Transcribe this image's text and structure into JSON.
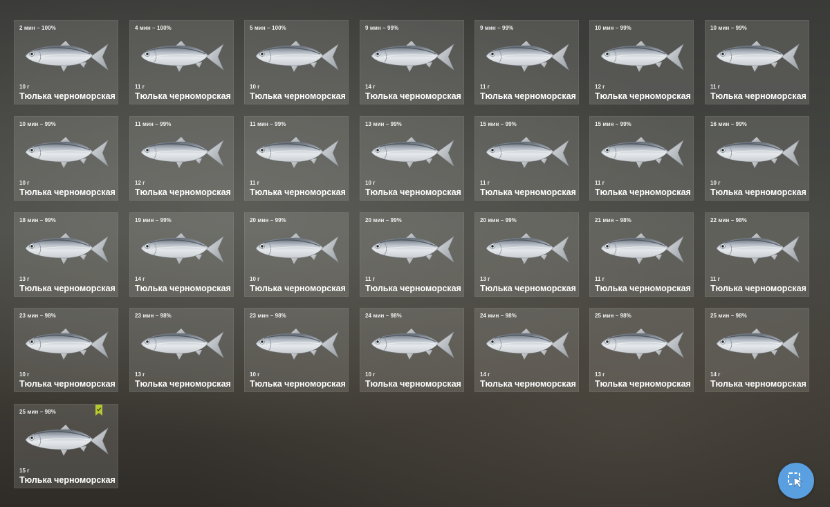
{
  "species_name": "Тюлька черноморская",
  "catches": [
    {
      "time": "2 мин – 100%",
      "weight": "10 г"
    },
    {
      "time": "4 мин – 100%",
      "weight": "11 г"
    },
    {
      "time": "5 мин – 100%",
      "weight": "10 г"
    },
    {
      "time": "9 мин – 99%",
      "weight": "14 г"
    },
    {
      "time": "9 мин – 99%",
      "weight": "11 г"
    },
    {
      "time": "10 мин – 99%",
      "weight": "12 г"
    },
    {
      "time": "10 мин – 99%",
      "weight": "11 г"
    },
    {
      "time": "10 мин – 99%",
      "weight": "10 г"
    },
    {
      "time": "11 мин – 99%",
      "weight": "12 г"
    },
    {
      "time": "11 мин – 99%",
      "weight": "11 г"
    },
    {
      "time": "13 мин – 99%",
      "weight": "10 г"
    },
    {
      "time": "15 мин – 99%",
      "weight": "11 г"
    },
    {
      "time": "15 мин – 99%",
      "weight": "11 г"
    },
    {
      "time": "16 мин – 99%",
      "weight": "10 г"
    },
    {
      "time": "18 мин – 99%",
      "weight": "13 г"
    },
    {
      "time": "19 мин – 99%",
      "weight": "14 г"
    },
    {
      "time": "20 мин – 99%",
      "weight": "10 г"
    },
    {
      "time": "20 мин – 99%",
      "weight": "11 г"
    },
    {
      "time": "20 мин – 99%",
      "weight": "13 г"
    },
    {
      "time": "21 мин – 98%",
      "weight": "11 г"
    },
    {
      "time": "22 мин – 98%",
      "weight": "11 г"
    },
    {
      "time": "23 мин – 98%",
      "weight": "10 г"
    },
    {
      "time": "23 мин – 98%",
      "weight": "13 г"
    },
    {
      "time": "23 мин – 98%",
      "weight": "10 г"
    },
    {
      "time": "24 мин – 98%",
      "weight": "10 г"
    },
    {
      "time": "24 мин – 98%",
      "weight": "14 г"
    },
    {
      "time": "25 мин – 98%",
      "weight": "13 г"
    },
    {
      "time": "25 мин – 98%",
      "weight": "14 г"
    },
    {
      "time": "25 мин – 98%",
      "weight": "15 г",
      "bookmarked": true
    }
  ],
  "icons": {
    "fish": "herring-fish-icon",
    "bookmark": "bookmark-icon",
    "cursor_button": "cursor-select-icon"
  },
  "colors": {
    "card_bg": "#b8b8b0",
    "bookmark": "#b5c832",
    "cursor_button": "#5a9fe0"
  }
}
